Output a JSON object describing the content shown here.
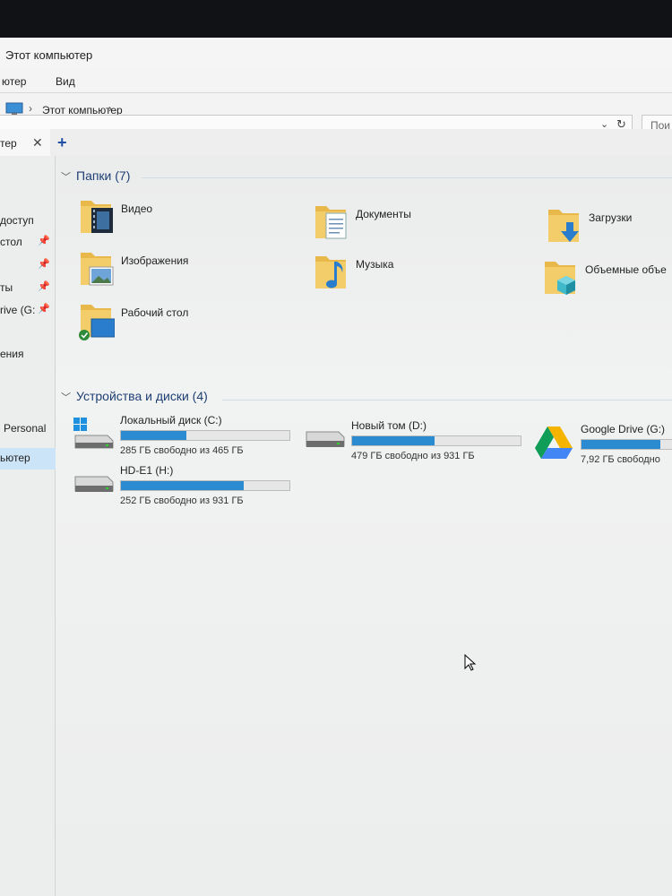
{
  "window": {
    "title": "Этот компьютер"
  },
  "ribbon": {
    "tab_computer": "ютер",
    "tab_view": "Вид"
  },
  "address": {
    "path": "Этот компьютер",
    "search_placeholder": "Пои"
  },
  "tabs": [
    {
      "label": "тер"
    }
  ],
  "sidebar": {
    "items": [
      {
        "label": "доступ",
        "pinned": false
      },
      {
        "label": "стол",
        "pinned": true
      },
      {
        "label": "",
        "pinned": true
      },
      {
        "label": "ты",
        "pinned": true
      },
      {
        "label": "rive (G:",
        "pinned": true
      },
      {
        "label": "ения",
        "pinned": false
      },
      {
        "label": "Personal",
        "pinned": false
      },
      {
        "label": "ьютер",
        "pinned": false,
        "selected": true
      }
    ]
  },
  "folders": {
    "header": "Папки (7)",
    "items": [
      {
        "name": "Видео",
        "icon": "video-folder-icon"
      },
      {
        "name": "Документы",
        "icon": "documents-folder-icon"
      },
      {
        "name": "Загрузки",
        "icon": "downloads-folder-icon"
      },
      {
        "name": "Изображения",
        "icon": "pictures-folder-icon"
      },
      {
        "name": "Музыка",
        "icon": "music-folder-icon"
      },
      {
        "name": "Объемные объе",
        "icon": "3d-objects-folder-icon"
      },
      {
        "name": "Рабочий стол",
        "icon": "desktop-folder-icon"
      }
    ]
  },
  "drives": {
    "header": "Устройства и диски (4)",
    "items": [
      {
        "name": "Локальный диск (C:)",
        "free": "285 ГБ свободно из 465 ГБ",
        "used_fraction": 0.39,
        "icon": "windows-drive-icon"
      },
      {
        "name": "Новый том (D:)",
        "free": "479 ГБ свободно из 931 ГБ",
        "used_fraction": 0.49,
        "icon": "hdd-icon"
      },
      {
        "name": "Google Drive (G:)",
        "free": "7,92 ГБ свободно",
        "used_fraction": 0.47,
        "icon": "google-drive-icon"
      },
      {
        "name": "HD-E1 (H:)",
        "free": "252 ГБ свободно из 931 ГБ",
        "used_fraction": 0.73,
        "icon": "hdd-icon"
      }
    ]
  },
  "colors": {
    "bar_fill": "#2a8bd0",
    "group_header": "#1e3f73",
    "selection": "#cce4f7"
  }
}
